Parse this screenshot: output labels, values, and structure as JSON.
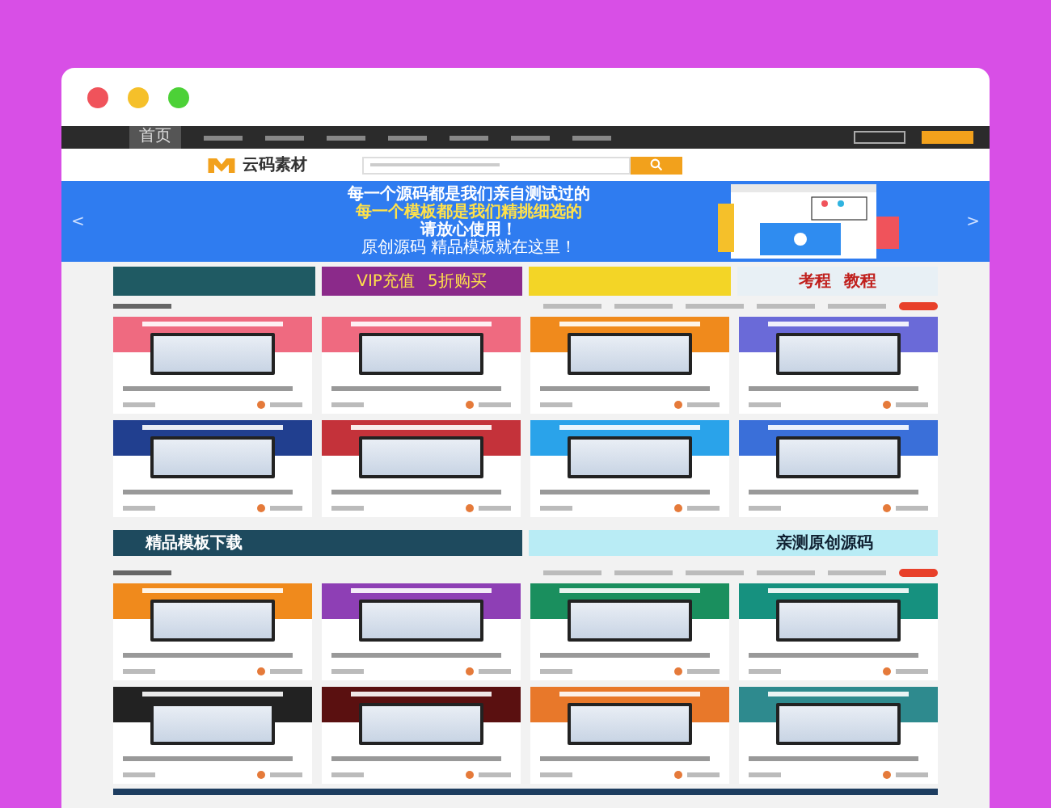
{
  "window": {
    "controls": [
      {
        "color": "#f0535b"
      },
      {
        "color": "#f5c02a"
      },
      {
        "color": "#4cd137"
      }
    ]
  },
  "top_nav": {
    "home": "首页"
  },
  "header": {
    "logo_text": "云码素材"
  },
  "banner": {
    "lines": [
      "每一个源码都是我们亲自测试过的",
      "每一个模板都是我们精挑细选的",
      "请放心使用！"
    ],
    "tagline": "原创源码 精品模板就在这里！",
    "prev": "<",
    "next": ">"
  },
  "ads": [
    {
      "kind": "server",
      "color": "#1f5a63"
    },
    {
      "kind": "vip",
      "texts": [
        "VIP充值",
        "5折购买"
      ],
      "color": "#8b2a8a"
    },
    {
      "kind": "event",
      "color": "#f3d526"
    },
    {
      "kind": "course",
      "texts": [
        "考程",
        "教程"
      ],
      "color": "#e8f0f5"
    }
  ],
  "sections": [
    {
      "cards": [
        {
          "color": "#ef6a80"
        },
        {
          "color": "#ef6a80"
        },
        {
          "color": "#f08a1c"
        },
        {
          "color": "#6a6ad8"
        },
        {
          "color": "#213f8f"
        },
        {
          "color": "#c4323a"
        },
        {
          "color": "#2aa3ea"
        },
        {
          "color": "#3a6fd9"
        }
      ]
    },
    {
      "cards": [
        {
          "color": "#f08a1c"
        },
        {
          "color": "#8e3fb5"
        },
        {
          "color": "#1a8f5e"
        },
        {
          "color": "#16917f"
        },
        {
          "color": "#222222"
        },
        {
          "color": "#5a1010"
        },
        {
          "color": "#e8782a"
        },
        {
          "color": "#2e8a8e"
        }
      ]
    }
  ],
  "wide_ads": [
    {
      "text": "精品模板下载",
      "color": "#1e4a5e"
    },
    {
      "text": "亲测原创源码",
      "color": "#b9ecf5"
    }
  ]
}
